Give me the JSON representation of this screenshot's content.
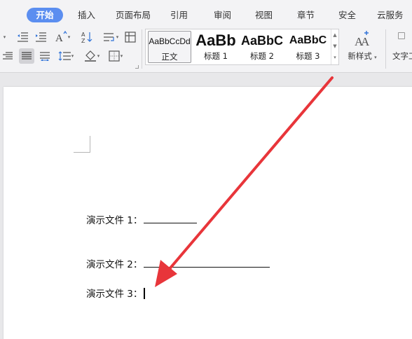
{
  "tabs": [
    {
      "label": "开始",
      "active": true
    },
    {
      "label": "插入"
    },
    {
      "label": "页面布局"
    },
    {
      "label": "引用"
    },
    {
      "label": "审阅"
    },
    {
      "label": "视图"
    },
    {
      "label": "章节"
    },
    {
      "label": "安全"
    },
    {
      "label": "云服务"
    }
  ],
  "styles": [
    {
      "preview": "AaBbCcDd",
      "name": "正文"
    },
    {
      "preview": "AaBb",
      "name": "标题 1"
    },
    {
      "preview": "AaBbC",
      "name": "标题 2"
    },
    {
      "preview": "AaBbC",
      "name": "标题 3"
    }
  ],
  "new_style_label": "新样式",
  "text_tool_label": "文字工",
  "document": {
    "lines": [
      {
        "label": "演示文件 1："
      },
      {
        "label": "演示文件 2："
      },
      {
        "label": "演示文件 3："
      }
    ]
  },
  "colors": {
    "accent": "#5b8ef0",
    "arrow": "#e8353a"
  }
}
